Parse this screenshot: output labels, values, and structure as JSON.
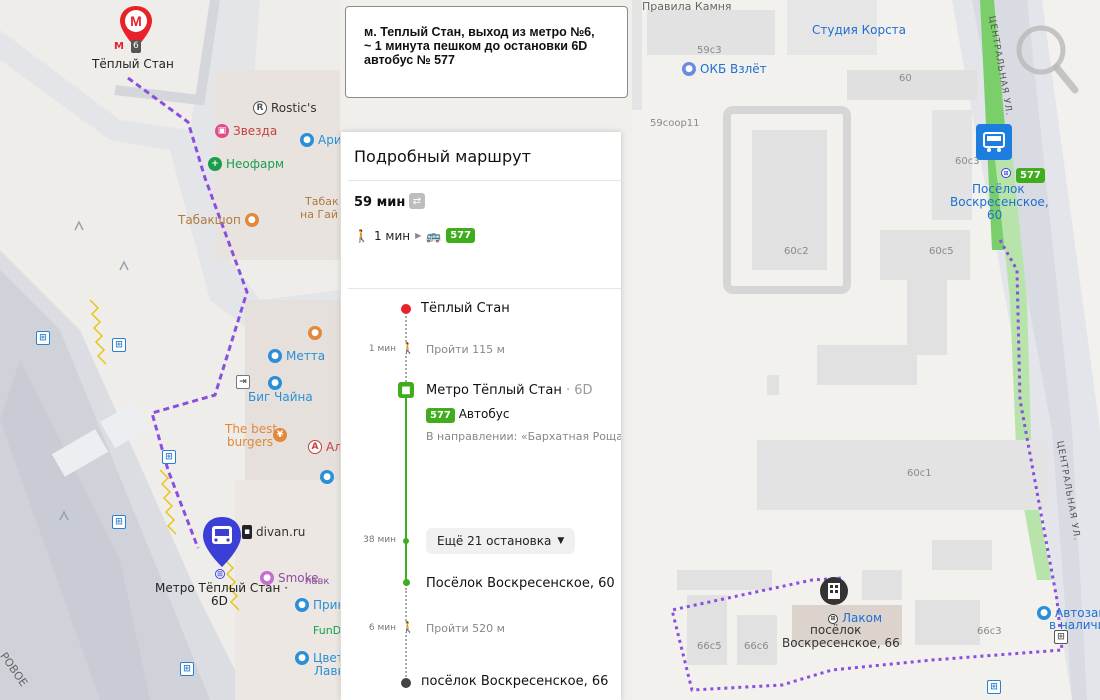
{
  "note": {
    "line1": "м. Теплый Стан,  выход из метро №6,",
    "line2": "~ 1 минута пешком до остановки 6D",
    "line3": "автобус № 577"
  },
  "panel": {
    "title": "Подробный маршрут",
    "duration": "59 мин",
    "walk_summary": "1 мин",
    "bus_number": "577",
    "stops": [
      {
        "name": "Тёплый Стан",
        "suffix": ""
      },
      {
        "name": "Метро Тёплый Стан",
        "suffix": " · 6D"
      },
      {
        "name": "Посёлок Воскресенское, 60",
        "suffix": ""
      },
      {
        "name": "посёлок Воскресенское, 66",
        "suffix": ""
      }
    ],
    "walk1_time": "1 мин",
    "walk1_text": "Пройти 115 м",
    "bus_label": "Автобус",
    "direction": "В направлении: «Бархатная Роща»",
    "ride_time": "38 мин",
    "more_stops": "Ещё 21 остановка",
    "walk2_time": "6 мин",
    "walk2_text": "Пройти 520 м"
  },
  "map_left": {
    "metro_letter": "M",
    "metro_exit": "6",
    "metro_name": "Тёплый Стан",
    "stop_name_line1": "Метро Тёплый Стан ·",
    "stop_name_line2": "6D",
    "pois": {
      "rostics": "Rostic's",
      "zvezda": "Звезда",
      "neofarm": "Неофарм",
      "ari": "Ари",
      "tabakshop": "Табакшоп",
      "tabak_na": "Табак",
      "tabak_na2": "на Гай",
      "metta": "Метта",
      "big_chaina": "Биг Чайна",
      "best_burgers1": "The best",
      "best_burgers2": "burgers",
      "al": "Ал",
      "divan": "divan.ru",
      "smoke": "Smoke",
      "smoke2": "лавк",
      "prin": "Прин",
      "fundo": "FunD",
      "tsvet": "Цвет",
      "lavk": "Лавк"
    }
  },
  "map_right": {
    "pravila": "Правила Камня",
    "b59c3": "59с3",
    "korsta": "Студия Корста",
    "okb": "ОКБ Взлёт",
    "b60": "60",
    "b59": "59соор11",
    "b60c2": "60с2",
    "b60c5": "60с5",
    "b60c1": "60с1",
    "b60c3": "60с3",
    "b66c5": "66с5",
    "b66c6": "66с6",
    "b66c3": "66с3",
    "street": "ЦЕНТРАЛЬНАЯ УЛ.",
    "street2": "ЦЕНТРАЛЬНАЯ УЛ.",
    "bus_badge": "577",
    "stop1": "Посёлок",
    "stop2": "Воскресенское,",
    "stop3": "60",
    "lakom": "Лаком",
    "dest1": "посёлок",
    "dest2": "Воскресенское, 66",
    "avtozap1": "Автозапч",
    "avtozap2": "в наличи"
  },
  "colors": {
    "route_walk": "#8a4fe0",
    "bus_green": "#3fad1d",
    "metro_red": "#e8222b",
    "pin_blue": "#3b3fd6"
  }
}
